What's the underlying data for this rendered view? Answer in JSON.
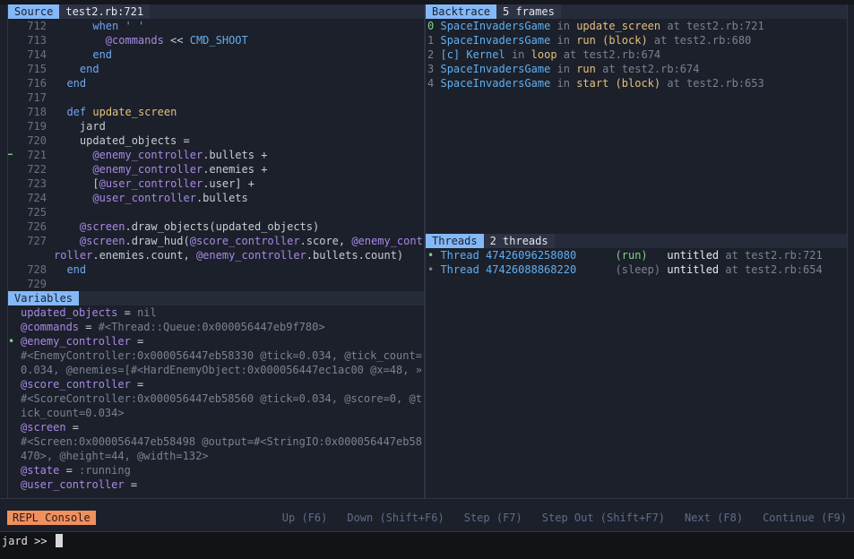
{
  "source": {
    "label": "Source",
    "location": "test2.rb:721",
    "current_line": "721",
    "lines": [
      {
        "n": "712",
        "tokens": [
          {
            "c": "pl",
            "t": "      "
          },
          {
            "c": "kw",
            "t": "when"
          },
          {
            "c": "st",
            "t": " ' '"
          }
        ]
      },
      {
        "n": "713",
        "tokens": [
          {
            "c": "pl",
            "t": "        "
          },
          {
            "c": "iv",
            "t": "@commands"
          },
          {
            "c": "pl",
            "t": " << "
          },
          {
            "c": "ct",
            "t": "CMD_SHOOT"
          }
        ]
      },
      {
        "n": "714",
        "tokens": [
          {
            "c": "pl",
            "t": "      "
          },
          {
            "c": "kw",
            "t": "end"
          }
        ]
      },
      {
        "n": "715",
        "tokens": [
          {
            "c": "pl",
            "t": "    "
          },
          {
            "c": "kw",
            "t": "end"
          }
        ]
      },
      {
        "n": "716",
        "tokens": [
          {
            "c": "pl",
            "t": "  "
          },
          {
            "c": "kw",
            "t": "end"
          }
        ]
      },
      {
        "n": "717",
        "tokens": []
      },
      {
        "n": "718",
        "tokens": [
          {
            "c": "pl",
            "t": "  "
          },
          {
            "c": "kw",
            "t": "def"
          },
          {
            "c": "pl",
            "t": " "
          },
          {
            "c": "mt",
            "t": "update_screen"
          }
        ]
      },
      {
        "n": "719",
        "tokens": [
          {
            "c": "pl",
            "t": "    jard"
          }
        ]
      },
      {
        "n": "720",
        "tokens": [
          {
            "c": "pl",
            "t": "    updated_objects ="
          }
        ]
      },
      {
        "n": "721",
        "tokens": [
          {
            "c": "pl",
            "t": "      "
          },
          {
            "c": "iv",
            "t": "@enemy_controller"
          },
          {
            "c": "pl",
            "t": ".bullets +"
          }
        ]
      },
      {
        "n": "722",
        "tokens": [
          {
            "c": "pl",
            "t": "      "
          },
          {
            "c": "iv",
            "t": "@enemy_controller"
          },
          {
            "c": "pl",
            "t": ".enemies +"
          }
        ]
      },
      {
        "n": "723",
        "tokens": [
          {
            "c": "pl",
            "t": "      ["
          },
          {
            "c": "iv",
            "t": "@user_controller"
          },
          {
            "c": "pl",
            "t": ".user] +"
          }
        ]
      },
      {
        "n": "724",
        "tokens": [
          {
            "c": "pl",
            "t": "      "
          },
          {
            "c": "iv",
            "t": "@user_controller"
          },
          {
            "c": "pl",
            "t": ".bullets"
          }
        ]
      },
      {
        "n": "725",
        "tokens": []
      },
      {
        "n": "726",
        "tokens": [
          {
            "c": "pl",
            "t": "    "
          },
          {
            "c": "iv",
            "t": "@screen"
          },
          {
            "c": "pl",
            "t": ".draw_objects(updated_objects)"
          }
        ]
      },
      {
        "n": "727",
        "tokens": [
          {
            "c": "pl",
            "t": "    "
          },
          {
            "c": "iv",
            "t": "@screen"
          },
          {
            "c": "pl",
            "t": ".draw_hud("
          },
          {
            "c": "iv",
            "t": "@score_controller"
          },
          {
            "c": "pl",
            "t": ".score, "
          },
          {
            "c": "iv",
            "t": "@enemy_controller"
          },
          {
            "c": "pl",
            "t": ".enemies.count, "
          },
          {
            "c": "iv",
            "t": "@enemy_controller"
          },
          {
            "c": "pl",
            "t": ".bullets.count)"
          }
        ]
      },
      {
        "n": "728",
        "tokens": [
          {
            "c": "pl",
            "t": "  "
          },
          {
            "c": "kw",
            "t": "end"
          }
        ]
      },
      {
        "n": "729",
        "tokens": []
      }
    ]
  },
  "variables": {
    "label": "Variables",
    "items": [
      {
        "name": "updated_objects",
        "eq": " = ",
        "value": "nil",
        "inline": true,
        "marked": false
      },
      {
        "name": "@commands",
        "eq": " = ",
        "value": "#<Thread::Queue:0x000056447eb9f780>",
        "inline": true,
        "marked": false
      },
      {
        "name": "@enemy_controller",
        "eq": " =",
        "value": "#<EnemyController:0x000056447eb58330 @tick=0.034, @tick_count=0.034, @enemies=[#<HardEnemyObject:0x000056447ec1ac00 @x=48, »",
        "inline": false,
        "marked": true
      },
      {
        "name": "@score_controller",
        "eq": " =",
        "value": "#<ScoreController:0x000056447eb58560 @tick=0.034, @score=0, @tick_count=0.034>",
        "inline": false,
        "marked": false
      },
      {
        "name": "@screen",
        "eq": " =",
        "value": "#<Screen:0x000056447eb58498 @output=#<StringIO:0x000056447eb58470>, @height=44, @width=132>",
        "inline": false,
        "marked": false
      },
      {
        "name": "@state",
        "eq": " = ",
        "value": ":running",
        "inline": true,
        "marked": false
      },
      {
        "name": "@user_controller",
        "eq": " =",
        "value": "",
        "inline": true,
        "marked": false
      }
    ]
  },
  "backtrace": {
    "label": "Backtrace",
    "info": "5 frames",
    "frames": [
      {
        "idx": "0",
        "prefix": "",
        "cls": "SpaceInvadersGame",
        "in": " in ",
        "method": "update_screen",
        "at": " at test2.rb:721",
        "current": true
      },
      {
        "idx": "1",
        "prefix": "",
        "cls": "SpaceInvadersGame",
        "in": " in ",
        "method": "run (block)",
        "at": " at test2.rb:680",
        "current": false
      },
      {
        "idx": "2",
        "prefix": "[c] ",
        "cls": "Kernel",
        "in": " in ",
        "method": "loop",
        "at": " at test2.rb:674",
        "current": false
      },
      {
        "idx": "3",
        "prefix": "",
        "cls": "SpaceInvadersGame",
        "in": " in ",
        "method": "run",
        "at": " at test2.rb:674",
        "current": false
      },
      {
        "idx": "4",
        "prefix": "",
        "cls": "SpaceInvadersGame",
        "in": " in ",
        "method": "start (block)",
        "at": " at test2.rb:653",
        "current": false
      }
    ]
  },
  "threads": {
    "label": "Threads",
    "info": "2 threads",
    "items": [
      {
        "name": "Thread 47426096258080",
        "status": "(run)  ",
        "title": "untitled",
        "at": " at test2.rb:721",
        "current": true
      },
      {
        "name": "Thread 47426088868220",
        "status": "(sleep)",
        "title": "untitled",
        "at": " at test2.rb:654",
        "current": false
      }
    ]
  },
  "toolbar": {
    "repl": "REPL Console",
    "keys": [
      "Up (F6)",
      "Down (Shift+F6)",
      "Step (F7)",
      "Step Out (Shift+F7)",
      "Next (F8)",
      "Continue (F9)"
    ]
  },
  "terminal": {
    "prompt": "jard >> "
  },
  "colors": {
    "accent": "#84b8f7",
    "repl": "#f0905f",
    "current": "#7ed67e"
  }
}
